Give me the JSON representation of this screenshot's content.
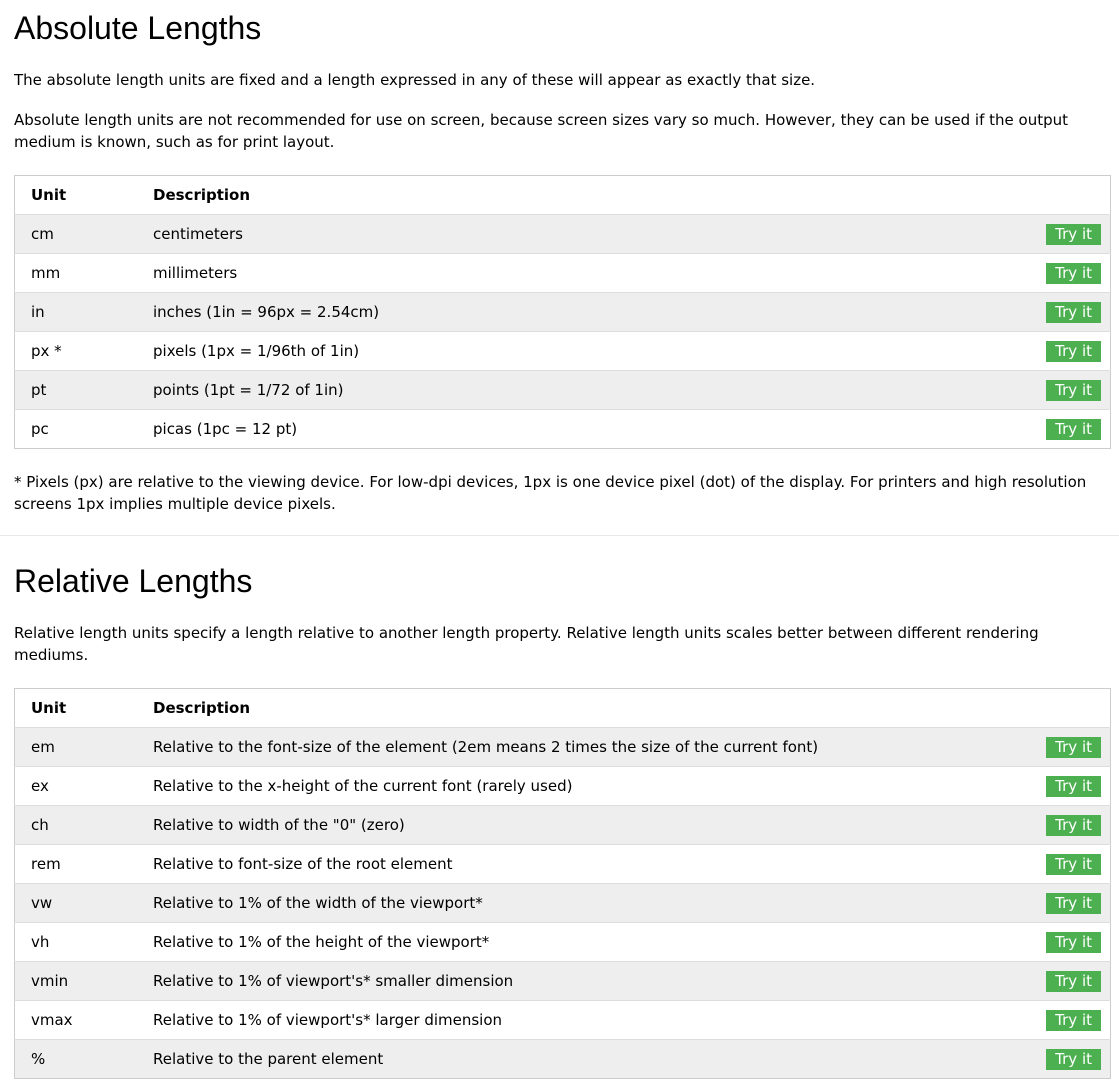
{
  "absolute": {
    "title": "Absolute Lengths",
    "intro1": "The absolute length units are fixed and a length expressed in any of these will appear as exactly that size.",
    "intro2": "Absolute length units are not recommended for use on screen, because screen sizes vary so much. However, they can be used if the output medium is known, such as for print layout.",
    "headers": {
      "unit": "Unit",
      "description": "Description"
    },
    "rows": [
      {
        "unit": "cm",
        "description": "centimeters",
        "button": "Try it"
      },
      {
        "unit": "mm",
        "description": "millimeters",
        "button": "Try it"
      },
      {
        "unit": "in",
        "description": "inches (1in = 96px = 2.54cm)",
        "button": "Try it"
      },
      {
        "unit": "px *",
        "description": "pixels (1px = 1/96th of 1in)",
        "button": "Try it"
      },
      {
        "unit": "pt",
        "description": "points (1pt = 1/72 of 1in)",
        "button": "Try it"
      },
      {
        "unit": "pc",
        "description": "picas (1pc = 12 pt)",
        "button": "Try it"
      }
    ],
    "note": "* Pixels (px) are relative to the viewing device. For low-dpi devices, 1px is one device pixel (dot) of the display. For printers and high resolution screens 1px implies multiple device pixels."
  },
  "relative": {
    "title": "Relative Lengths",
    "intro": "Relative length units specify a length relative to another length property. Relative length units scales better between different rendering mediums.",
    "headers": {
      "unit": "Unit",
      "description": "Description"
    },
    "rows": [
      {
        "unit": "em",
        "description": "Relative to the font-size of the element (2em means 2 times the size of the current font)",
        "button": "Try it"
      },
      {
        "unit": "ex",
        "description": "Relative to the x-height of the current font (rarely used)",
        "button": "Try it"
      },
      {
        "unit": "ch",
        "description": "Relative to width of the \"0\" (zero)",
        "button": "Try it"
      },
      {
        "unit": "rem",
        "description": "Relative to font-size of the root element",
        "button": "Try it"
      },
      {
        "unit": "vw",
        "description": "Relative to 1% of the width of the viewport*",
        "button": "Try it"
      },
      {
        "unit": "vh",
        "description": "Relative to 1% of the height of the viewport*",
        "button": "Try it"
      },
      {
        "unit": "vmin",
        "description": "Relative to 1% of viewport's* smaller dimension",
        "button": "Try it"
      },
      {
        "unit": "vmax",
        "description": "Relative to 1% of viewport's* larger dimension",
        "button": "Try it"
      },
      {
        "unit": "%",
        "description": "Relative to the parent element",
        "button": "Try it"
      }
    ]
  },
  "colors": {
    "button_bg": "#4caf50",
    "button_text": "#ffffff",
    "row_alt_bg": "#eeeeee",
    "table_border": "#cccccc"
  }
}
